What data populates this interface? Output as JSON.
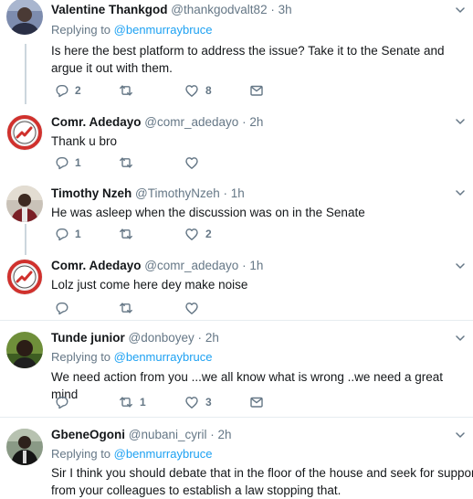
{
  "tweets": [
    {
      "name": "Valentine Thankgod",
      "handle": "@thankgodvalt82",
      "time": "3h",
      "reply_prefix": "Replying to ",
      "reply_mention": "@benmurraybruce",
      "text": "Is here the best platform to address the issue? Take it to the Senate and argue it out with them.",
      "replies": "2",
      "retweets": "",
      "likes": "8"
    },
    {
      "name": "Comr. Adedayo",
      "handle": "@comr_adedayo",
      "time": "2h",
      "text": "Thank u bro",
      "replies": "1",
      "retweets": "",
      "likes": ""
    },
    {
      "name": "Timothy Nzeh",
      "handle": "@TimothyNzeh",
      "time": "1h",
      "text": "He was asleep when the discussion was on in the Senate",
      "replies": "1",
      "retweets": "",
      "likes": "2"
    },
    {
      "name": "Comr. Adedayo",
      "handle": "@comr_adedayo",
      "time": "1h",
      "text": "Lolz just come here dey make noise",
      "replies": "",
      "retweets": "",
      "likes": ""
    },
    {
      "name": "Tunde junior",
      "handle": "@donboyey",
      "time": "2h",
      "reply_prefix": "Replying to ",
      "reply_mention": "@benmurraybruce",
      "text": "We need action from you ...we all know what is wrong ..we need a great mind",
      "replies": "",
      "retweets": "1",
      "likes": "3"
    },
    {
      "name": "GbeneOgoni",
      "handle": "@nubani_cyril",
      "time": "2h",
      "reply_prefix": "Replying to ",
      "reply_mention": "@benmurraybruce",
      "text_line1": "Sir I think you should debate that in the floor of the house and seek for support",
      "text_line2": "from your colleagues to establish a law stopping that."
    }
  ],
  "separator": "·",
  "icons": {
    "reply": "reply-icon",
    "retweet": "retweet-icon",
    "like": "like-icon",
    "dm": "direct-message-icon",
    "caret": "chevron-down-icon"
  },
  "colors": {
    "text": "#14171a",
    "secondary": "#657786",
    "link": "#1da1f2",
    "divider": "#e6ecf0",
    "thread_line": "#ccd6dd"
  }
}
